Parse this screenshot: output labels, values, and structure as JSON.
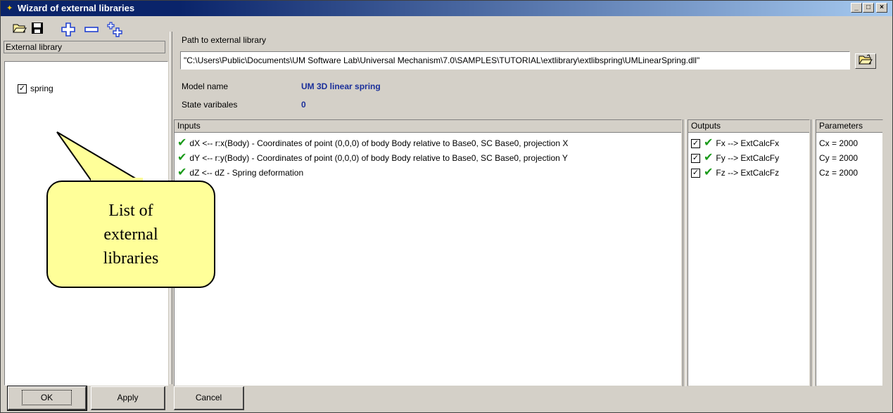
{
  "window": {
    "title": "Wizard of external libraries"
  },
  "toolbar": {
    "open": "open-icon",
    "save": "save-icon",
    "add": "add-icon",
    "remove": "remove-icon",
    "add_multiple": "add-multiple-icon"
  },
  "library_list": {
    "header": "External library",
    "items": [
      {
        "label": "spring",
        "checked": true
      }
    ]
  },
  "path": {
    "label": "Path to external library",
    "value": "\"C:\\Users\\Public\\Documents\\UM Software Lab\\Universal Mechanism\\7.0\\SAMPLES\\TUTORIAL\\extlibrary\\extlibspring\\UMLinearSpring.dll\""
  },
  "model": {
    "name_label": "Model name",
    "name_value": "UM 3D linear spring",
    "state_label": "State varibales",
    "state_value": "0"
  },
  "inputs": {
    "header": "Inputs",
    "rows": [
      "dX <-- r:x(Body) - Coordinates of point (0,0,0) of body Body relative to Base0, SC Base0, projection X",
      "dY <-- r:y(Body) - Coordinates of point (0,0,0) of body Body relative to Base0, SC Base0, projection Y",
      "dZ <-- dZ - Spring deformation"
    ]
  },
  "outputs": {
    "header": "Outputs",
    "rows": [
      "Fx --> ExtCalcFx",
      "Fy --> ExtCalcFy",
      "Fz --> ExtCalcFz"
    ]
  },
  "parameters": {
    "header": "Parameters",
    "rows": [
      "Cx = 2000",
      "Cy = 2000",
      "Cz = 2000"
    ]
  },
  "callout": {
    "text": "List of external libraries"
  },
  "buttons": {
    "ok": "OK",
    "apply": "Apply",
    "cancel": "Cancel"
  },
  "colors": {
    "titlebar": "#0a246a",
    "accent_text": "#1a2f9a",
    "check": "#1a9a1a",
    "callout": "#ffff99"
  }
}
